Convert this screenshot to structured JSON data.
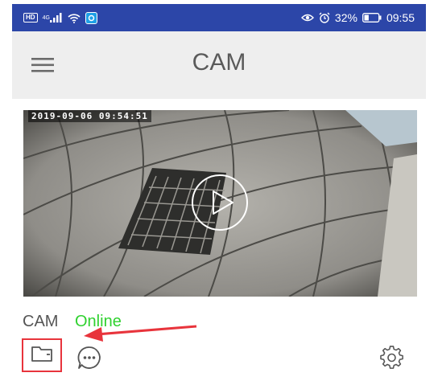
{
  "status_bar": {
    "left_icons": [
      "hd-icon",
      "cellular-signal-icon",
      "wifi-icon",
      "app-notification-icon"
    ],
    "hd_label": "HD",
    "network_label": "4G",
    "right_icons": [
      "eye-icon",
      "alarm-icon"
    ],
    "battery_percent": "32%",
    "battery_level": 0.32,
    "time": "09:55"
  },
  "app_bar": {
    "menu_icon": "hamburger-menu-icon",
    "title": "CAM"
  },
  "camera_card": {
    "timestamp": "2019-09-06 09:54:51",
    "play_icon": "play-icon",
    "name": "CAM",
    "status": "Online",
    "status_color": "#2fd12f",
    "actions": {
      "folder_icon": "folder-icon",
      "message_icon": "message-icon",
      "settings_icon": "gear-icon"
    }
  },
  "annotation": {
    "highlight_color": "#e8343c"
  }
}
